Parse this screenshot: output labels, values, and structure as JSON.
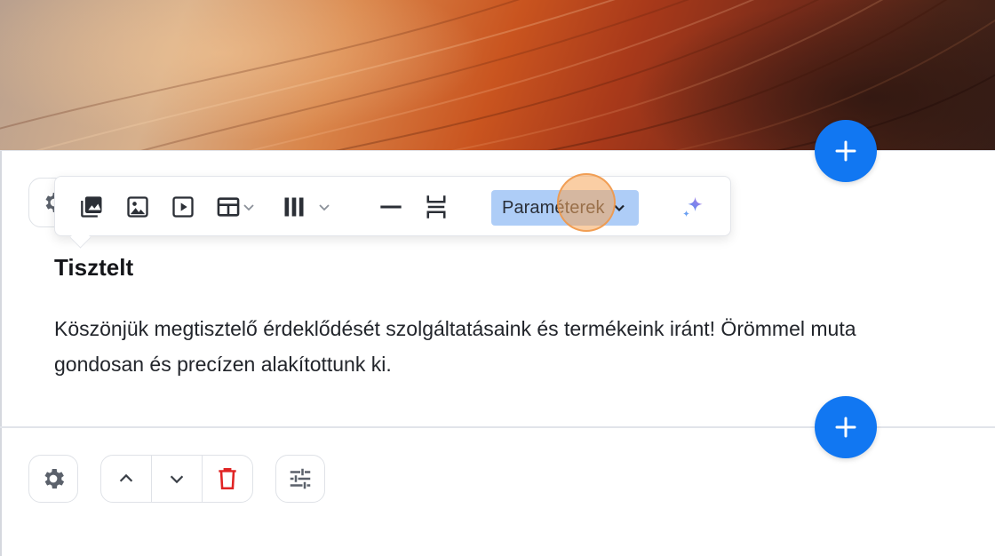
{
  "content": {
    "heading": "Tisztelt",
    "paragraph_line1": "Köszönjük megtisztelő érdeklődését szolgáltatásaink és termékeink iránt! Örömmel muta",
    "paragraph_line2": "gondosan és precízen alakítottunk ki."
  },
  "toolbar": {
    "items": [
      "gallery-icon",
      "image-icon",
      "video-icon",
      "table-icon",
      "columns-icon",
      "horizontal-line-icon",
      "spacer-icon",
      "sparkle-icon"
    ],
    "parameters_label": "Paraméterek"
  },
  "section_controls": {
    "items": [
      "gear-icon",
      "chevron-up-icon",
      "chevron-down-icon",
      "trash-icon",
      "sliders-icon"
    ]
  },
  "colors": {
    "accent": "#1177f2",
    "parameters_bg": "#aecdf7",
    "danger": "#e02424",
    "icon": "#2b2f36"
  }
}
